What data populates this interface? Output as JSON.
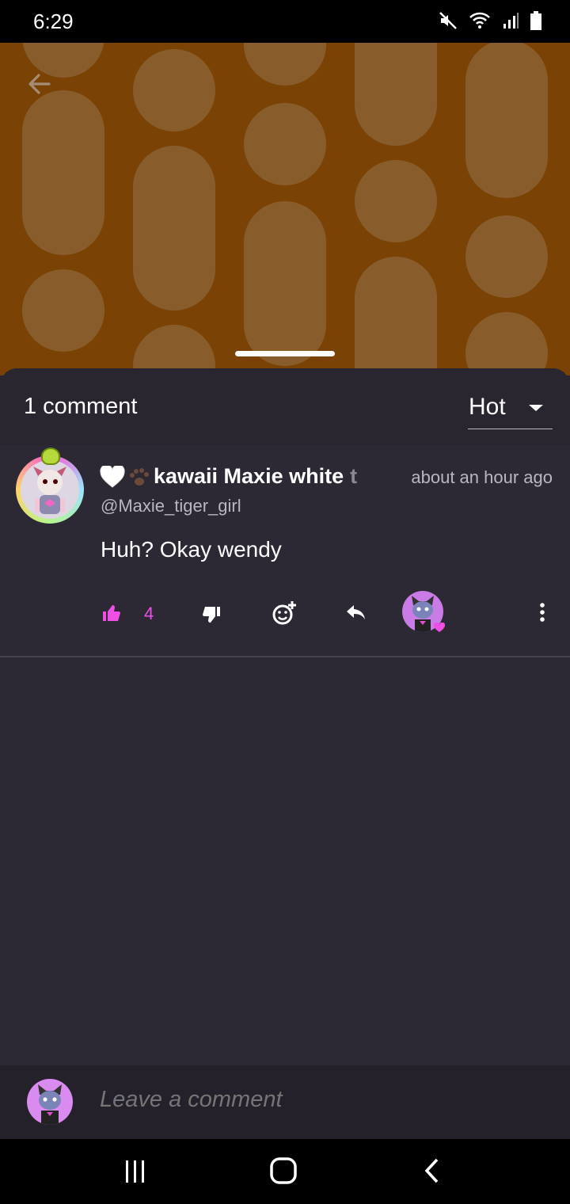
{
  "status_bar": {
    "time": "6:29"
  },
  "comments_sheet": {
    "count_label": "1 comment",
    "sort": {
      "selected": "Hot"
    }
  },
  "comment": {
    "username": "kawaii Maxie white",
    "username_trailing": "t",
    "handle": "@Maxie_tiger_girl",
    "timestamp": "about an hour ago",
    "text": "Huh? Okay wendy",
    "like_count": "4"
  },
  "composer": {
    "placeholder": "Leave a comment"
  },
  "colors": {
    "accent": "#ef4fe5",
    "header_bg": "#7a4204",
    "sheet_bg": "#2d2934"
  }
}
